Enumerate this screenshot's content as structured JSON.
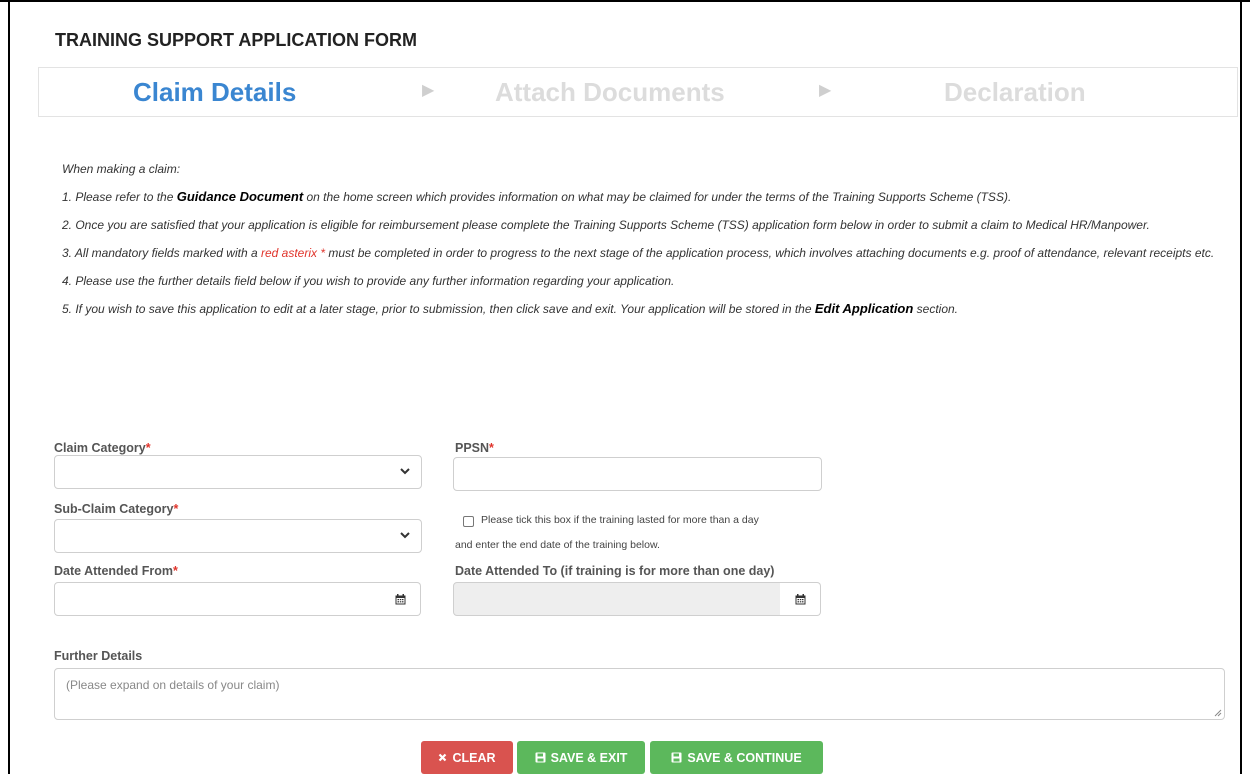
{
  "form": {
    "title": "TRAINING SUPPORT APPLICATION FORM"
  },
  "steps": [
    {
      "label": "Claim Details",
      "state": "active"
    },
    {
      "label": "Attach Documents",
      "state": "inactive"
    },
    {
      "label": "Declaration",
      "state": "inactive"
    }
  ],
  "instructions": {
    "intro": "When making a claim:",
    "item1_pre": "1. Please refer to the ",
    "item1_em": "Guidance Document",
    "item1_post": " on the home screen which provides information on what may be claimed for under the terms of the Training Supports Scheme (TSS).",
    "item2": "2. Once you are satisfied that your application is eligible for reimbursement please complete the Training Supports Scheme (TSS) application form below in order to submit a claim to Medical HR/Manpower.",
    "item3_pre": "3. All mandatory fields marked with a ",
    "item3_red": "red asterix *",
    "item3_post": " must be completed in order to progress to the next stage of the application process, which involves attaching documents e.g. proof of attendance, relevant receipts etc.",
    "item4": "4. Please use the further details field below if you wish to provide any further information regarding your application.",
    "item5_pre": "5. If you wish to save this application to edit at a later stage, prior to submission, then click save and exit. Your application will be stored in the ",
    "item5_em": "Edit Application",
    "item5_post": " section."
  },
  "fields": {
    "claim_category": {
      "label": "Claim Category",
      "required_mark": "*",
      "value": ""
    },
    "ppsn": {
      "label": "PPSN",
      "required_mark": "*",
      "value": ""
    },
    "sub_claim_category": {
      "label": "Sub-Claim Category",
      "required_mark": "*",
      "value": ""
    },
    "multi_day": {
      "line1": "Please tick this box if the training lasted for more than a day",
      "line2": "and enter the end date of the training below.",
      "checked": false
    },
    "date_from": {
      "label": "Date Attended From",
      "required_mark": "*",
      "value": ""
    },
    "date_to": {
      "label": "Date Attended To (if training is for more than one day)",
      "value": "",
      "disabled": true
    },
    "further_details": {
      "label": "Further Details",
      "placeholder": "(Please expand on details of your claim)"
    }
  },
  "buttons": {
    "clear": {
      "label": "CLEAR",
      "icon": "times-icon",
      "color": "#d9534f"
    },
    "save_exit": {
      "label": "SAVE & EXIT",
      "icon": "floppy-disk-icon",
      "color": "#5cb85c"
    },
    "save_continue": {
      "label": "SAVE & CONTINUE",
      "icon": "floppy-disk-icon",
      "color": "#5cb85c"
    }
  },
  "colors": {
    "step_active": "#3a86d1",
    "step_inactive": "#dcdcdc",
    "required": "#e0342b"
  }
}
